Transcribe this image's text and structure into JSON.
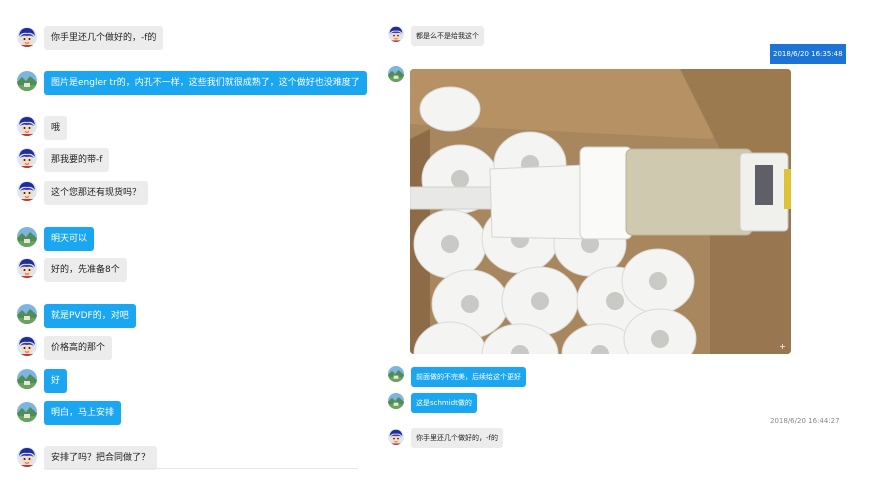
{
  "left_chat": {
    "messages": [
      {
        "avatar": "blue-haired-avatar",
        "style": "gray",
        "text": "你手里还几个做好的，-f的"
      },
      {
        "avatar": "landscape-avatar",
        "style": "blue",
        "text": "图片是engler tr的，内孔不一样，这些我们就很成熟了，这个做好也没难度了"
      },
      {
        "avatar": "blue-haired-avatar",
        "style": "gray",
        "text": "哦"
      },
      {
        "avatar": "blue-haired-avatar",
        "style": "gray",
        "text": "那我要的带-f"
      },
      {
        "avatar": "blue-haired-avatar",
        "style": "gray",
        "text": "这个您那还有现货吗？"
      },
      {
        "avatar": "landscape-avatar",
        "style": "blue",
        "text": "明天可以"
      },
      {
        "avatar": "blue-haired-avatar",
        "style": "gray",
        "text": "好的，先准备8个"
      },
      {
        "avatar": "landscape-avatar",
        "style": "blue",
        "text": "就是PVDF的，对吧"
      },
      {
        "avatar": "blue-haired-avatar",
        "style": "gray",
        "text": "价格高的那个"
      },
      {
        "avatar": "landscape-avatar",
        "style": "blue",
        "text": "好"
      },
      {
        "avatar": "landscape-avatar",
        "style": "blue",
        "text": "明白，马上安排"
      },
      {
        "avatar": "blue-haired-avatar",
        "style": "gray",
        "text": "安排了吗？把合同做了？"
      }
    ]
  },
  "right_chat": {
    "msg1": {
      "avatar": "blue-haired-avatar",
      "text": "都是么不是给我这个"
    },
    "timestamp1": "2018/6/20 16:35:48",
    "photo": {
      "avatar": "landscape-avatar",
      "description_icon": "expand-icon"
    },
    "msg2": {
      "avatar": "landscape-avatar",
      "text": "前面做的不完美，后续给这个更好"
    },
    "msg3": {
      "avatar": "landscape-avatar",
      "text": "这是schmidt做的"
    },
    "timestamp2": "2018/6/20 16:44:27",
    "msg4": {
      "avatar": "blue-haired-avatar",
      "text": "你手里还几个做好的，-f的"
    }
  },
  "colors": {
    "gray_bubble": "#ececec",
    "blue_bubble": "#1aa6f0",
    "timestamp_selected": "#1b74d6"
  }
}
